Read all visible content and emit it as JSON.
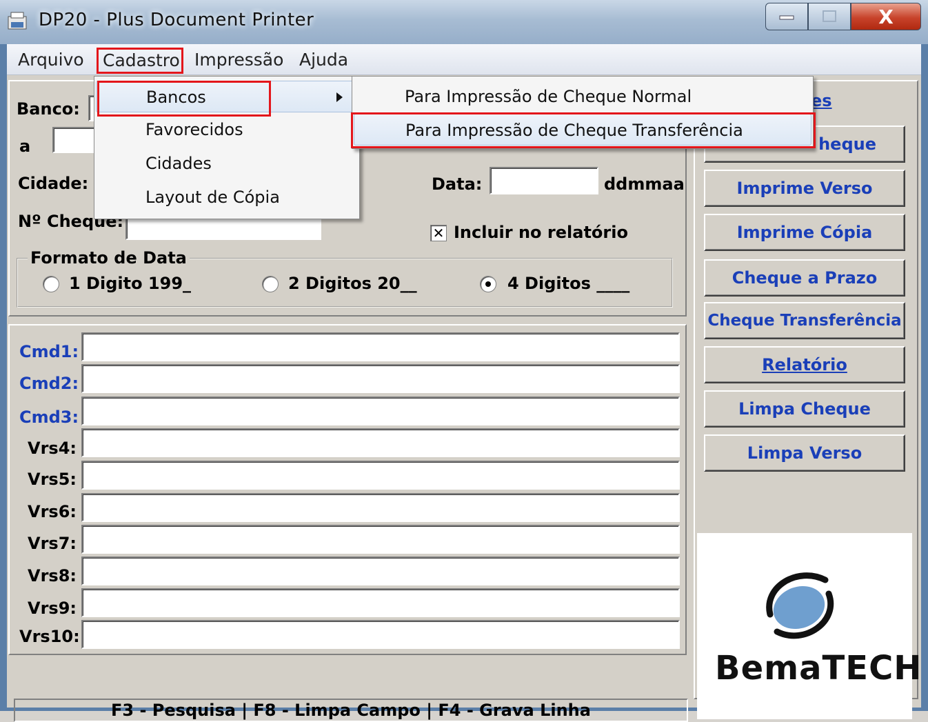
{
  "window": {
    "title": "DP20 - Plus Document Printer",
    "close_glyph": "X"
  },
  "menubar": {
    "items": [
      "Arquivo",
      "Cadastro",
      "Impressão",
      "Ajuda"
    ]
  },
  "cadastro_menu": {
    "items": [
      "Bancos",
      "Favorecidos",
      "Cidades",
      "Layout de Cópia"
    ]
  },
  "bancos_submenu": {
    "items": [
      "Para Impressão de Cheque Normal",
      "Para Impressão de Cheque Transferência"
    ]
  },
  "form": {
    "banco_label": "Banco:",
    "a_label": "a",
    "cidade_label": "Cidade:",
    "data_label": "Data:",
    "data_format": "ddmmaa",
    "numero_cheque_label": "Nº Cheque:",
    "incluir_label": "Incluir no relatório",
    "incluir_checked_glyph": "✕",
    "formato_title": "Formato de Data",
    "formato_options": [
      "1 Digito 199_",
      "2 Digitos 20__",
      "4 Digitos ____"
    ]
  },
  "commands": {
    "labels": [
      "Cmd1:",
      "Cmd2:",
      "Cmd3:",
      "Vrs4:",
      "Vrs5:",
      "Vrs6:",
      "Vrs7:",
      "Vrs8:",
      "Vrs9:",
      "Vrs10:"
    ]
  },
  "side_panel": {
    "header_fragment": "es",
    "buttons": [
      "heque",
      "Imprime Verso",
      "Imprime Cópia",
      "Cheque a Prazo",
      "Cheque Transferência",
      "Relatório",
      "Limpa Cheque",
      "Limpa Verso"
    ]
  },
  "logo": {
    "text": "BemaTECH"
  },
  "statusbar": {
    "text": "F3 - Pesquisa  |  F8 - Limpa Campo  |  F4 - Grava Linha"
  }
}
